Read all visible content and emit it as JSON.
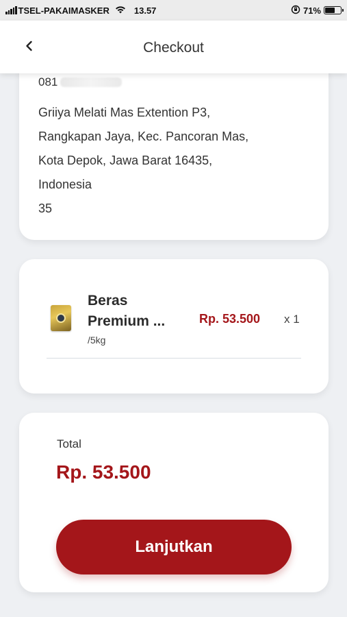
{
  "status_bar": {
    "carrier": "TSEL-PAKAIMASKER",
    "time": "13.57",
    "battery": "71%",
    "battery_level": 0.71,
    "icons": [
      "signal-icon",
      "wifi-icon",
      "rotation-lock-icon",
      "battery-icon"
    ]
  },
  "header": {
    "title": "Checkout",
    "back_icon": "chevron-left-icon"
  },
  "address": {
    "phone": "081",
    "lines": [
      "Griiya Melati Mas Extention P3,",
      "Rangkapan Jaya, Kec. Pancoran Mas,",
      "Kota Depok, Jawa Barat 16435,",
      "Indonesia",
      "35"
    ]
  },
  "order": {
    "items": [
      {
        "name": "Beras Premium ...",
        "unit": "/5kg",
        "price": "Rp. 53.500",
        "qty": "x 1"
      }
    ]
  },
  "total": {
    "label": "Total",
    "amount": "Rp. 53.500",
    "button_label": "Lanjutkan"
  },
  "colors": {
    "accent": "#a4161a",
    "background": "#eef0f3",
    "card": "#ffffff"
  }
}
